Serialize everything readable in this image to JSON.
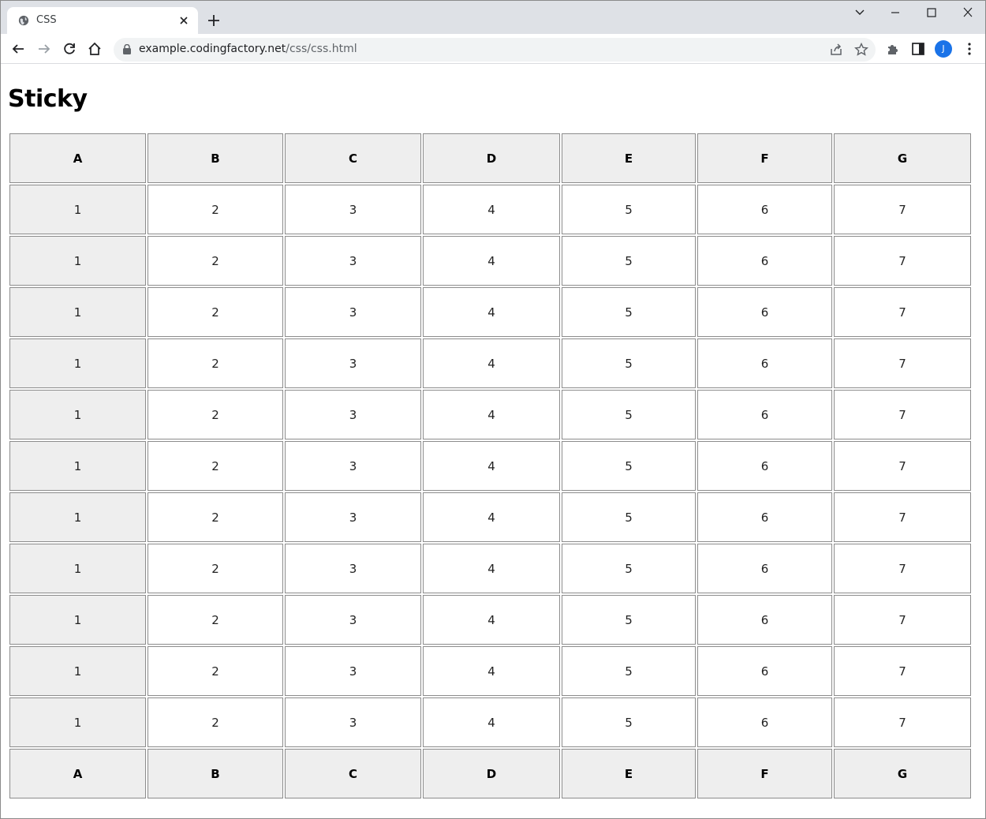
{
  "browser": {
    "tab_title": "CSS",
    "url_host": "example.codingfactory.net",
    "url_path": "/css/css.html",
    "profile_initial": "J",
    "accent": "#1a73e8"
  },
  "page": {
    "heading": "Sticky",
    "table": {
      "header": [
        "A",
        "B",
        "C",
        "D",
        "E",
        "F",
        "G"
      ],
      "rows": [
        [
          "1",
          "2",
          "3",
          "4",
          "5",
          "6",
          "7"
        ],
        [
          "1",
          "2",
          "3",
          "4",
          "5",
          "6",
          "7"
        ],
        [
          "1",
          "2",
          "3",
          "4",
          "5",
          "6",
          "7"
        ],
        [
          "1",
          "2",
          "3",
          "4",
          "5",
          "6",
          "7"
        ],
        [
          "1",
          "2",
          "3",
          "4",
          "5",
          "6",
          "7"
        ],
        [
          "1",
          "2",
          "3",
          "4",
          "5",
          "6",
          "7"
        ],
        [
          "1",
          "2",
          "3",
          "4",
          "5",
          "6",
          "7"
        ],
        [
          "1",
          "2",
          "3",
          "4",
          "5",
          "6",
          "7"
        ],
        [
          "1",
          "2",
          "3",
          "4",
          "5",
          "6",
          "7"
        ],
        [
          "1",
          "2",
          "3",
          "4",
          "5",
          "6",
          "7"
        ],
        [
          "1",
          "2",
          "3",
          "4",
          "5",
          "6",
          "7"
        ]
      ],
      "footer": [
        "A",
        "B",
        "C",
        "D",
        "E",
        "F",
        "G"
      ]
    }
  }
}
